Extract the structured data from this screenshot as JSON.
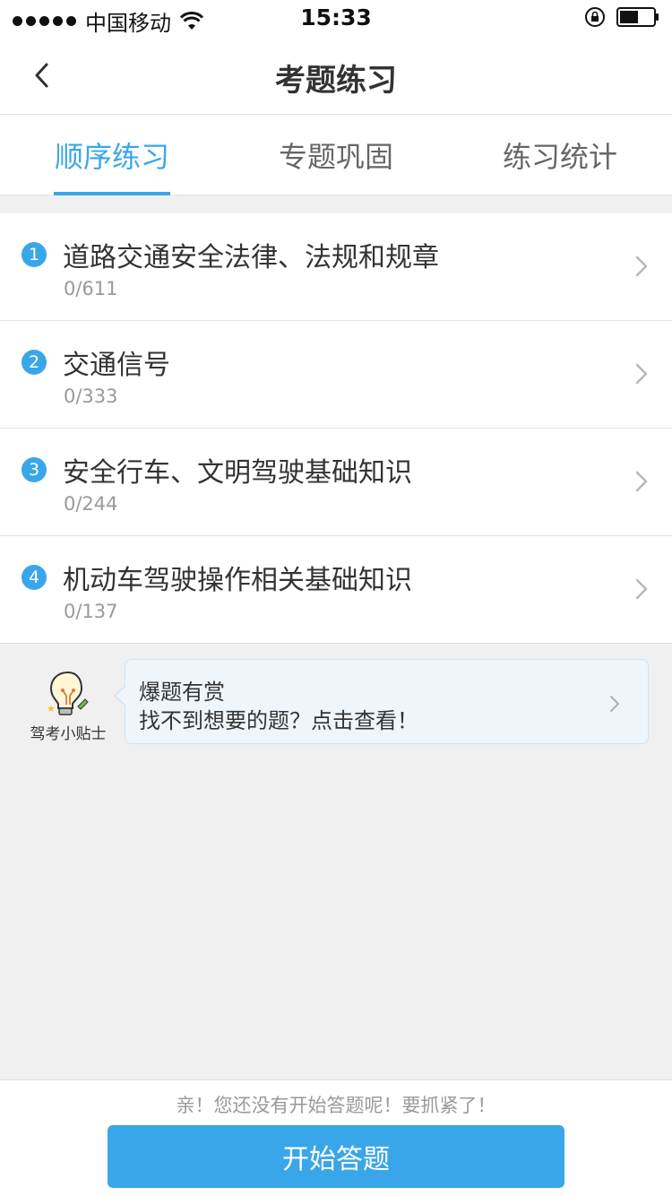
{
  "status_bar": {
    "carrier": "中国移动",
    "time": "15:33"
  },
  "nav": {
    "title": "考题练习"
  },
  "tabs": [
    {
      "label": "顺序练习",
      "active": true
    },
    {
      "label": "专题巩固",
      "active": false
    },
    {
      "label": "练习统计",
      "active": false
    }
  ],
  "chapters": [
    {
      "num": "1",
      "title": "道路交通安全法律、法规和规章",
      "progress": "0/611"
    },
    {
      "num": "2",
      "title": "交通信号",
      "progress": "0/333"
    },
    {
      "num": "3",
      "title": "安全行车、文明驾驶基础知识",
      "progress": "0/244"
    },
    {
      "num": "4",
      "title": "机动车驾驶操作相关基础知识",
      "progress": "0/137"
    }
  ],
  "tip": {
    "mascot_label": "驾考小贴士",
    "title": "爆题有赏",
    "text": "找不到想要的题？点击查看！"
  },
  "footer": {
    "hint": "亲！您还没有开始答题呢！要抓紧了！",
    "start_button": "开始答题"
  },
  "colors": {
    "accent": "#3aa6ea",
    "background": "#f0f0f0"
  }
}
